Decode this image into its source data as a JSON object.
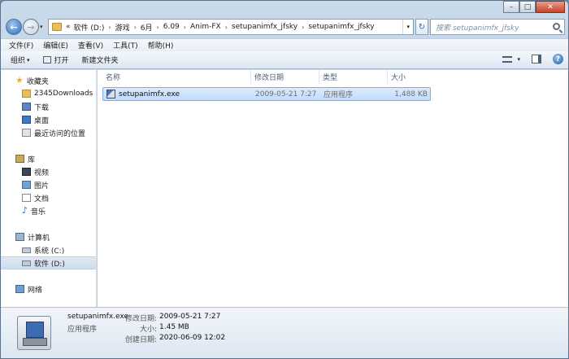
{
  "window": {
    "minimize_glyph": "–",
    "maximize_glyph": "□",
    "close_glyph": "✕"
  },
  "nav": {
    "back_glyph": "←",
    "forward_glyph": "→",
    "history_glyph": "▾",
    "refresh_glyph": "↻"
  },
  "address": {
    "prefix": "«",
    "crumbs": [
      "软件 (D:)",
      "游戏",
      "6月",
      "6.09",
      "Anim-FX",
      "setupanimfx_jfsky",
      "setupanimfx_jfsky"
    ],
    "separator": "›",
    "dropdown_glyph": "▾"
  },
  "search": {
    "placeholder": "搜索 setupanimfx_jfsky"
  },
  "menu": {
    "items": [
      "文件(F)",
      "编辑(E)",
      "查看(V)",
      "工具(T)",
      "帮助(H)"
    ]
  },
  "toolbar": {
    "organize": "组织",
    "open": "打开",
    "new_folder": "新建文件夹",
    "caret": "▾",
    "help_glyph": "?"
  },
  "sidebar": {
    "favorites": {
      "header": "收藏夹",
      "items": [
        "2345Downloads",
        "下载",
        "桌面",
        "最近访问的位置"
      ]
    },
    "libraries": {
      "header": "库",
      "items": [
        "视频",
        "图片",
        "文档",
        "音乐"
      ]
    },
    "computer": {
      "header": "计算机",
      "items": [
        "系统 (C:)",
        "软件 (D:)"
      ]
    },
    "network": {
      "header": "网络"
    }
  },
  "columns": {
    "name": "名称",
    "date": "修改日期",
    "type": "类型",
    "size": "大小"
  },
  "files": [
    {
      "name": "setupanimfx.exe",
      "date": "2009-05-21 7:27",
      "type": "应用程序",
      "size": "1,488 KB"
    }
  ],
  "details": {
    "name": "setupanimfx.exe",
    "kind": "应用程序",
    "modified_label": "修改日期:",
    "modified_value": "2009-05-21 7:27",
    "size_label": "大小:",
    "size_value": "1.45 MB",
    "created_label": "创建日期:",
    "created_value": "2020-06-09 12:02"
  }
}
